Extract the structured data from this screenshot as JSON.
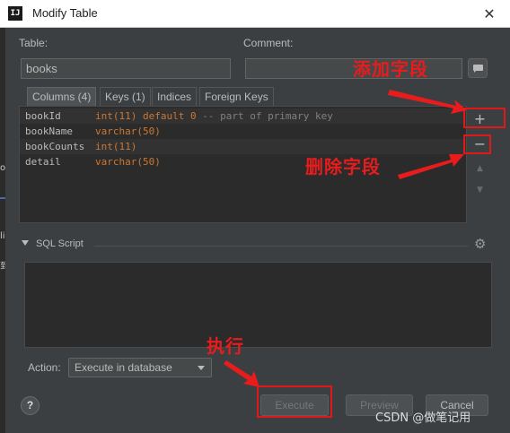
{
  "window": {
    "app_icon_text": "IJ",
    "title": "Modify Table",
    "close_glyph": "✕"
  },
  "background_ide": {
    "fragments": [
      "or",
      "li",
      "到"
    ]
  },
  "form": {
    "table_label": "Table:",
    "table_value": "books",
    "comment_label": "Comment:",
    "comment_value": ""
  },
  "tabs": [
    {
      "label": "Columns (4)",
      "active": true
    },
    {
      "label": "Keys (1)",
      "active": false
    },
    {
      "label": "Indices",
      "active": false
    },
    {
      "label": "Foreign Keys",
      "active": false
    }
  ],
  "columns": [
    {
      "name": "bookId",
      "type": "int(11) default 0",
      "comment": "-- part of primary key",
      "selected": true
    },
    {
      "name": "bookName",
      "type": "varchar(50)",
      "comment": "",
      "selected": false
    },
    {
      "name": "bookCounts",
      "type": "int(11)",
      "comment": "",
      "selected": true
    },
    {
      "name": "detail",
      "type": "varchar(50)",
      "comment": "",
      "selected": false
    }
  ],
  "side_toolbar": {
    "add_glyph": "+",
    "remove_glyph": "−",
    "up_glyph": "▲",
    "down_glyph": "▼"
  },
  "sql_script": {
    "label": "SQL Script",
    "gear_glyph": "⚙",
    "content": ""
  },
  "action": {
    "label": "Action:",
    "selected": "Execute in database"
  },
  "buttons": {
    "help": "?",
    "execute": "Execute",
    "preview": "Preview",
    "cancel": "Cancel"
  },
  "annotations": {
    "add_field": "添加字段",
    "delete_field": "删除字段",
    "execute": "执行",
    "color": "#e01818"
  },
  "watermark": "CSDN @做笔记用"
}
